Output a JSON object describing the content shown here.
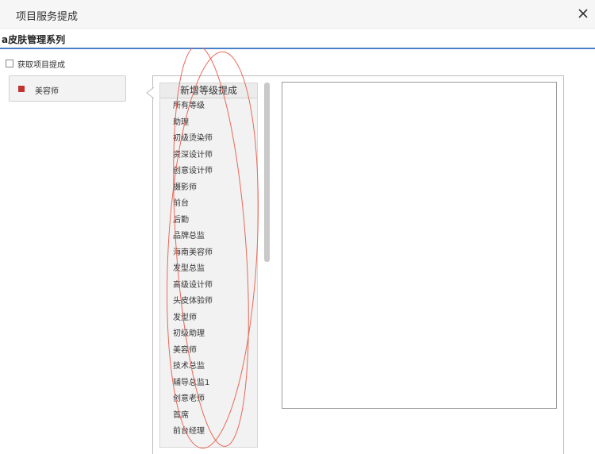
{
  "dialog": {
    "title": "项目服务提成",
    "close_icon": "close-icon"
  },
  "tab": {
    "label": "a皮肤管理系列"
  },
  "fetch_checkbox": {
    "label": "获取项目提成",
    "checked": false
  },
  "category": {
    "label": "美容师",
    "swatch_color": "#c0332e"
  },
  "level_list": {
    "header": "新增等级提成",
    "items": [
      "所有等级",
      "助理",
      "初级烫染师",
      "资深设计师",
      "创意设计师",
      "摄影师",
      "前台",
      "后勤",
      "品牌总监",
      "海南美容师",
      "发型总监",
      "高级设计师",
      "头皮体验师",
      "发型师",
      "初级助理",
      "美容师",
      "技术总监",
      "辅导总监1",
      "创意老师",
      "首席",
      "前台经理"
    ]
  },
  "annotation_color": "#e8695a",
  "accent_color": "#4a7fc9"
}
